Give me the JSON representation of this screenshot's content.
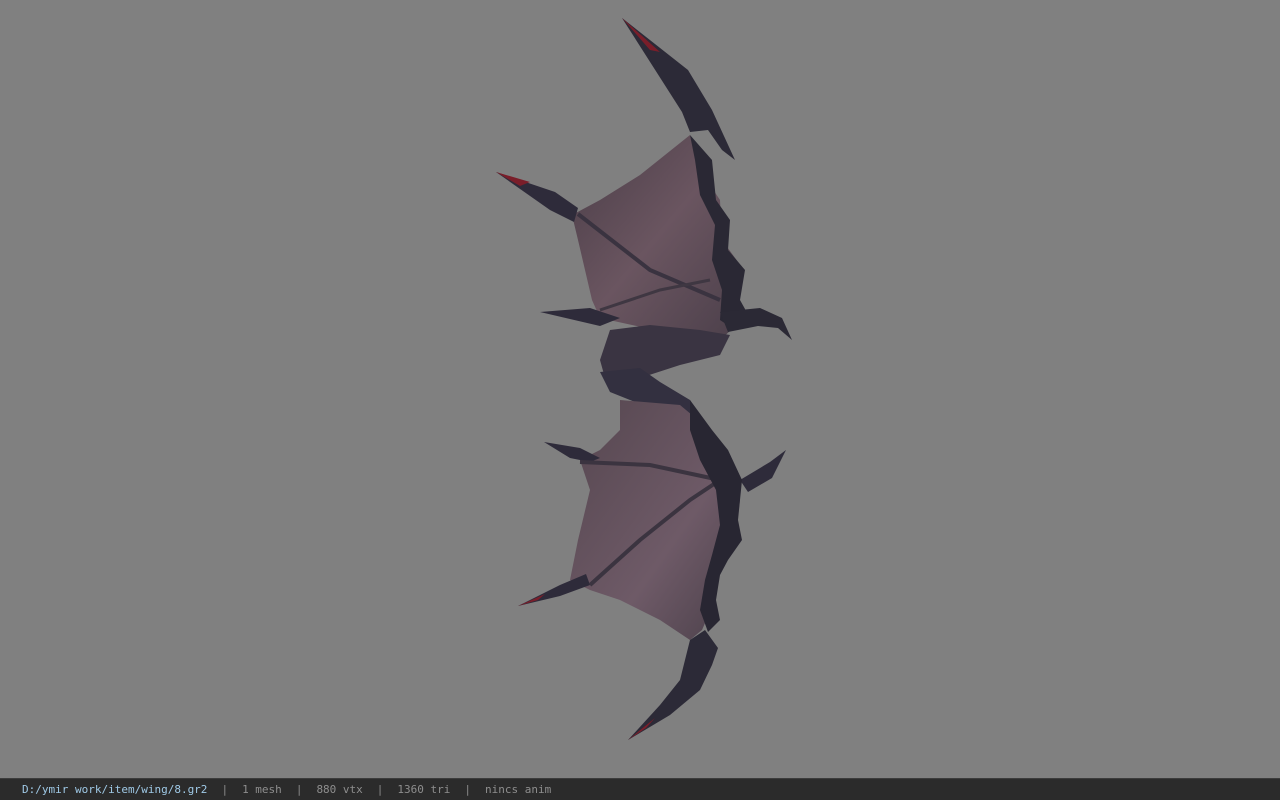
{
  "viewport": {
    "background_color": "#808080",
    "model_name": "wing",
    "membrane_color": "#5d4a55",
    "bone_color": "#2e2b3a",
    "claw_tip_color": "#7a1e2a"
  },
  "statusbar": {
    "file_path": "D:/ymir work/item/wing/8.gr2",
    "mesh_count": "1 mesh",
    "vertex_count": "880 vtx",
    "triangle_count": "1360 tri",
    "animation": "nincs anim",
    "separator": "|"
  }
}
